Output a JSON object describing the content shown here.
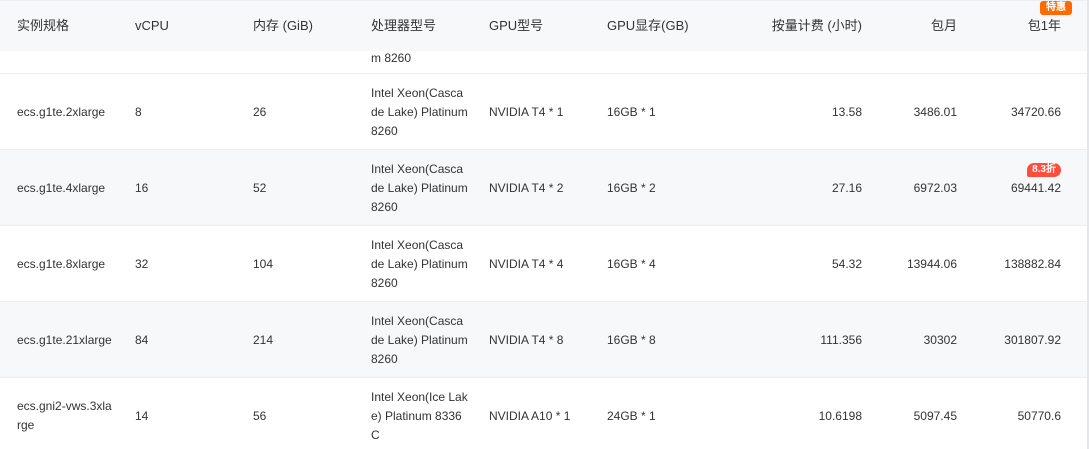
{
  "headers": {
    "spec": "实例规格",
    "vcpu": "vCPU",
    "memory": "内存 (GiB)",
    "processor": "处理器型号",
    "gpu": "GPU型号",
    "gpu_mem": "GPU显存(GB)",
    "hourly": "按量计费 (小时)",
    "monthly": "包月",
    "yearly": "包1年",
    "yearly_badge": "特惠"
  },
  "rows": [
    {
      "spec": "",
      "vcpu": "",
      "memory": "",
      "processor": "m 8260",
      "gpu": "",
      "gpu_mem": "",
      "hourly": "",
      "monthly": "",
      "yearly": "",
      "badge": ""
    },
    {
      "spec": "ecs.g1te.2xlarge",
      "vcpu": "8",
      "memory": "26",
      "processor": "Intel Xeon(Cascade Lake) Platinum 8260",
      "gpu": "NVIDIA T4 * 1",
      "gpu_mem": "16GB * 1",
      "hourly": "13.58",
      "monthly": "3486.01",
      "yearly": "34720.66",
      "badge": ""
    },
    {
      "spec": "ecs.g1te.4xlarge",
      "vcpu": "16",
      "memory": "52",
      "processor": "Intel Xeon(Cascade Lake) Platinum 8260",
      "gpu": "NVIDIA T4 * 2",
      "gpu_mem": "16GB * 2",
      "hourly": "27.16",
      "monthly": "6972.03",
      "yearly": "69441.42",
      "badge": "8.3折"
    },
    {
      "spec": "ecs.g1te.8xlarge",
      "vcpu": "32",
      "memory": "104",
      "processor": "Intel Xeon(Cascade Lake) Platinum 8260",
      "gpu": "NVIDIA T4 * 4",
      "gpu_mem": "16GB * 4",
      "hourly": "54.32",
      "monthly": "13944.06",
      "yearly": "138882.84",
      "badge": ""
    },
    {
      "spec": "ecs.g1te.21xlarge",
      "vcpu": "84",
      "memory": "214",
      "processor": "Intel Xeon(Cascade Lake) Platinum 8260",
      "gpu": "NVIDIA T4 * 8",
      "gpu_mem": "16GB * 8",
      "hourly": "111.356",
      "monthly": "30302",
      "yearly": "301807.92",
      "badge": ""
    },
    {
      "spec": "ecs.gni2-vws.3xlarge",
      "vcpu": "14",
      "memory": "56",
      "processor": "Intel Xeon(Ice Lake) Platinum 8336C",
      "gpu": "NVIDIA A10 * 1",
      "gpu_mem": "24GB * 1",
      "hourly": "10.6198",
      "monthly": "5097.45",
      "yearly": "50770.6",
      "badge": ""
    }
  ],
  "colors": {
    "header_bg": "#f7f8fa",
    "stripe_bg": "#f7f8fa",
    "badge_orange": "#ff6a00",
    "discount_red": "#ff4d3d",
    "text": "#333333"
  }
}
